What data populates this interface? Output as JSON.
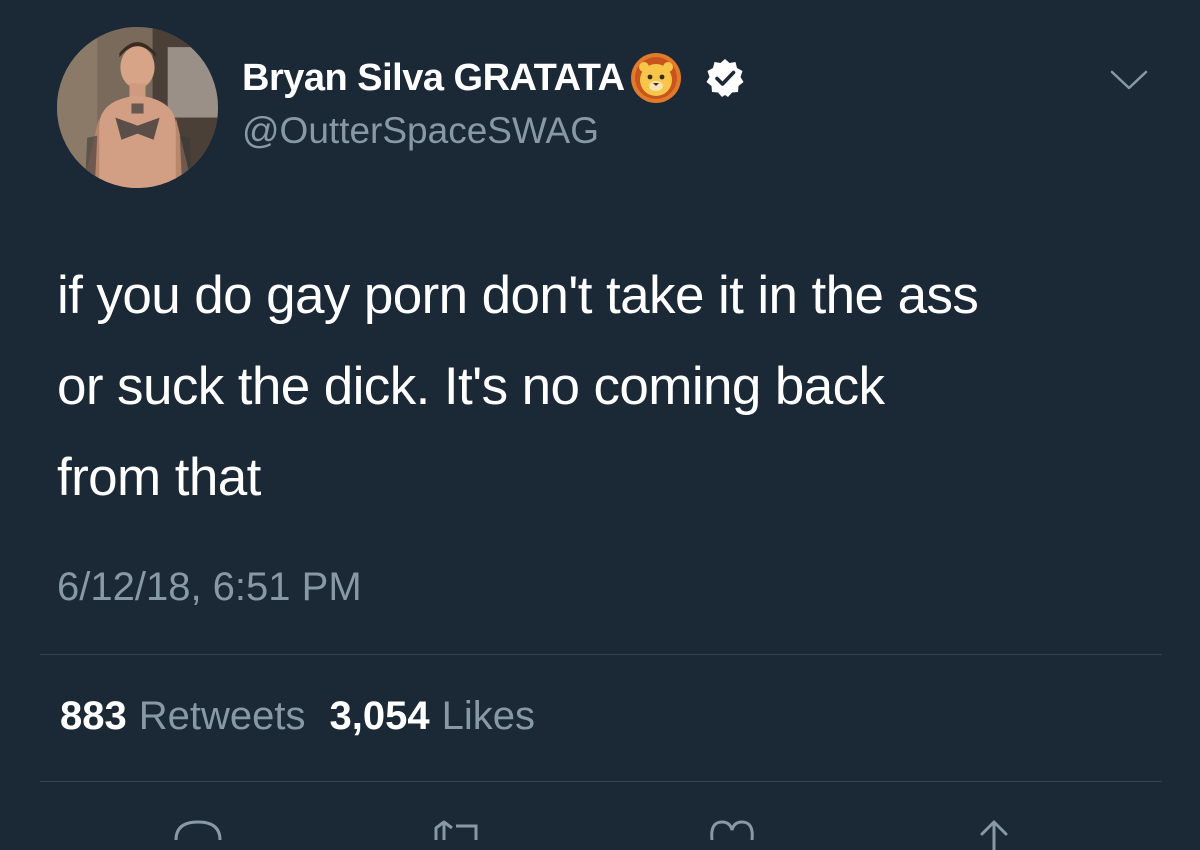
{
  "tweet": {
    "author": {
      "display_name": "Bryan Silva GRATATA",
      "handle": "@OutterSpaceSWAG",
      "name_emoji_icon": "lion-face-icon",
      "verified_icon": "verified-badge-icon"
    },
    "text": "if you do gay porn don't take it in the ass\nor suck the dick. It's no coming back\nfrom that",
    "timestamp": "6/12/18, 6:51 PM",
    "stats": {
      "retweets_count": "883",
      "retweets_label": "Retweets",
      "likes_count": "3,054",
      "likes_label": "Likes"
    },
    "actions": [
      "reply-icon",
      "retweet-icon",
      "like-icon",
      "share-icon"
    ]
  },
  "colors": {
    "background": "#1b2836",
    "primary_text": "#ffffff",
    "secondary_text": "#8899a6",
    "divider": "#38444d"
  }
}
